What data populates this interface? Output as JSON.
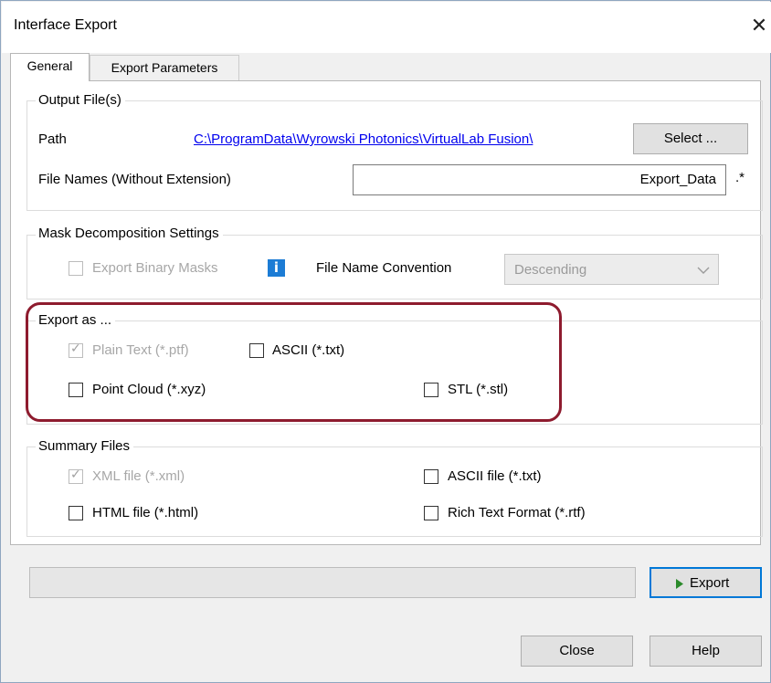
{
  "window": {
    "title": "Interface Export",
    "close_glyph": "✕"
  },
  "tabs": [
    {
      "label": "General",
      "active": true
    },
    {
      "label": "Export Parameters",
      "active": false
    }
  ],
  "output_files": {
    "group_label": "Output File(s)",
    "path_label": "Path",
    "path_value": "C:\\ProgramData\\Wyrowski Photonics\\VirtualLab Fusion\\",
    "select_button": "Select ...",
    "filename_label": "File Names (Without Extension)",
    "filename_value": "Export_Data",
    "extension_suffix": ".*"
  },
  "mask_settings": {
    "group_label": "Mask Decomposition Settings",
    "export_binary_masks": {
      "label": "Export Binary Masks",
      "checked": false,
      "enabled": false
    },
    "info_icon": "i",
    "convention_label": "File Name Convention",
    "convention_value": "Descending"
  },
  "export_as": {
    "group_label": "Export as ...",
    "plain_text": {
      "label": "Plain Text (*.ptf)",
      "checked": true,
      "enabled": false
    },
    "ascii": {
      "label": "ASCII (*.txt)",
      "checked": false,
      "enabled": true
    },
    "point_cloud": {
      "label": "Point Cloud (*.xyz)",
      "checked": false,
      "enabled": true
    },
    "stl": {
      "label": "STL (*.stl)",
      "checked": false,
      "enabled": true
    }
  },
  "summary_files": {
    "group_label": "Summary Files",
    "xml": {
      "label": "XML file (*.xml)",
      "checked": true,
      "enabled": false
    },
    "ascii": {
      "label": "ASCII file (*.txt)",
      "checked": false,
      "enabled": true
    },
    "html": {
      "label": "HTML file (*.html)",
      "checked": false,
      "enabled": true
    },
    "rtf": {
      "label": "Rich Text Format (*.rtf)",
      "checked": false,
      "enabled": true
    }
  },
  "progress": {
    "fraction": 0
  },
  "buttons": {
    "export": "Export",
    "close": "Close",
    "help": "Help"
  },
  "colors": {
    "link": "#0000ee",
    "info_icon": "#1c7cd5",
    "highlight": "#8e1b2e",
    "export_arrow": "#2a8a2a"
  }
}
